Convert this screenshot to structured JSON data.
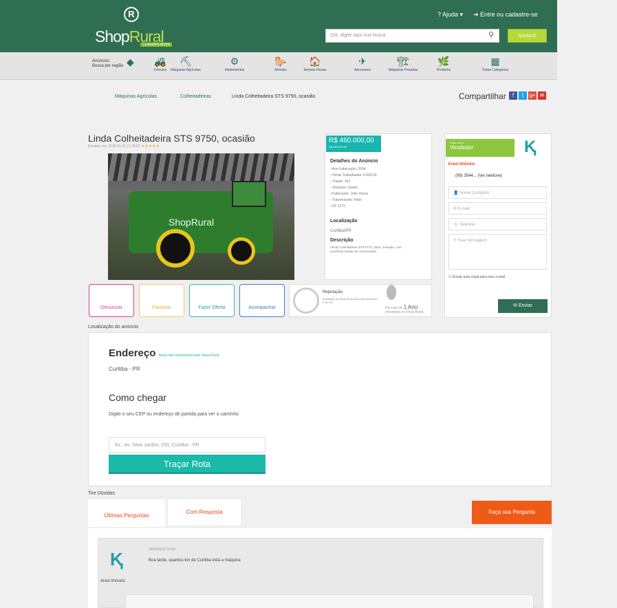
{
  "header": {
    "logo_mark": "R",
    "logo_a": "Shop",
    "logo_b": "Rural",
    "logo_sub": "CLASSIFICADOS",
    "help": "? Ajuda ▾",
    "login": "➜ Entre ou cadastre-se",
    "search_placeholder": "Olá, digite aqui sua busca",
    "search_btn": "ANUNCIE"
  },
  "region": {
    "line1": "Anúncios:",
    "line2": "Busca por região"
  },
  "categories": [
    "Veículos",
    "Máquinas Agrícolas",
    "Implementos",
    "Animais",
    "Imóveis Rurais",
    "Aeronaves",
    "Máquinas Pesadas",
    "Produtos",
    "Todas Categorias"
  ],
  "category_icons": [
    "🚜",
    "⛏",
    "⚙",
    "🐎",
    "🏠",
    "✈",
    "🏗",
    "🌿",
    "▦"
  ],
  "breadcrumb": [
    "Máquinas Agrícolas",
    "Colheitadeiras",
    "Linda Colheitadeira STS 9750, ocasião"
  ],
  "share": {
    "label": "Compartilhar",
    "fb": "f",
    "tw": "t",
    "gp": "g+",
    "mail": "✉"
  },
  "listing": {
    "title": "Linda Colheitadeira STS 9750, ocasião",
    "meta": "Enviado em: 2015-01-02 21:29:55",
    "stars": "★★★★★",
    "watermark": "ShopRural"
  },
  "details": {
    "price": "R$ 460.000,00",
    "price_sub": "R$ 460.000,00",
    "h_detalhes": "Detalhes do Anúncio",
    "lines": [
      "› Ano Fabricação: 2004",
      "› Horas Trabalhadas: 6.500,00",
      "› Tração: 4x2",
      "› Situação: Usado",
      "› Fabricante: John Deere",
      "› Transmissão: Hidro",
      "› ID: 2172"
    ],
    "h_loc": "Localização",
    "loc": "Curitiba/PR",
    "h_desc": "Descrição",
    "desc": "Vendo colheitadeira STS 9770, 2004, revisada, com excelente estado de conservação."
  },
  "seller": {
    "tag_small": "Falar com o",
    "tag": "Vendedor",
    "name": "Arauí Imóveis",
    "phone": "(99) 3544... (Ver telefone)",
    "f_name": "👤 Nome Completo",
    "f_email": "✉ E-mail",
    "f_phone": "☏ Telefone",
    "f_msg": "✎ Sua mensagem",
    "copy": "☐ Enviar uma cópia para meu e-mail",
    "send": "✉  Enviar"
  },
  "actions": {
    "denunciar": "Denunciar",
    "favoritar": "Favoritar",
    "oferta": "Fazer Oferta",
    "acompanhar": "Acompanhar"
  },
  "reputation": {
    "title": "Reputação",
    "text": "Avaliação do Shop Rural para este vendedor é de 0%.",
    "yrs_pre": "Há mais de",
    "yrs": "1 Ano",
    "yrs_post": "vendendo no Shop Rural"
  },
  "location": {
    "label": "Localização do anúncio",
    "end_title": "Endereço",
    "end_note": "Itarial não responsável pelo Shop Rural",
    "end_val": "Curitiba - PR",
    "como": "Como chegar",
    "como_desc": "Digite o seu CEP ou endereço de partida para ver o caminho",
    "route_placeholder": "Ex.: Av. Silva Jardim, 250, Curitiba - PR",
    "route_btn": "Traçar Rota"
  },
  "questions": {
    "label": "Tire Dúvidas",
    "tab1": "Últimas Perguntas",
    "tab2": "Com Resposta",
    "ask": "Faça sua Pergunta",
    "q_name": "Araxi Imóveis",
    "q_date": "03/01/2016 16:56",
    "q_text": "Boa tarde, quantos km de Curitiba está a máquina"
  },
  "colors": {
    "brand": "#2f6e52",
    "accent": "#b5d93a",
    "teal": "#1ab9a9",
    "orange": "#f05a17"
  }
}
